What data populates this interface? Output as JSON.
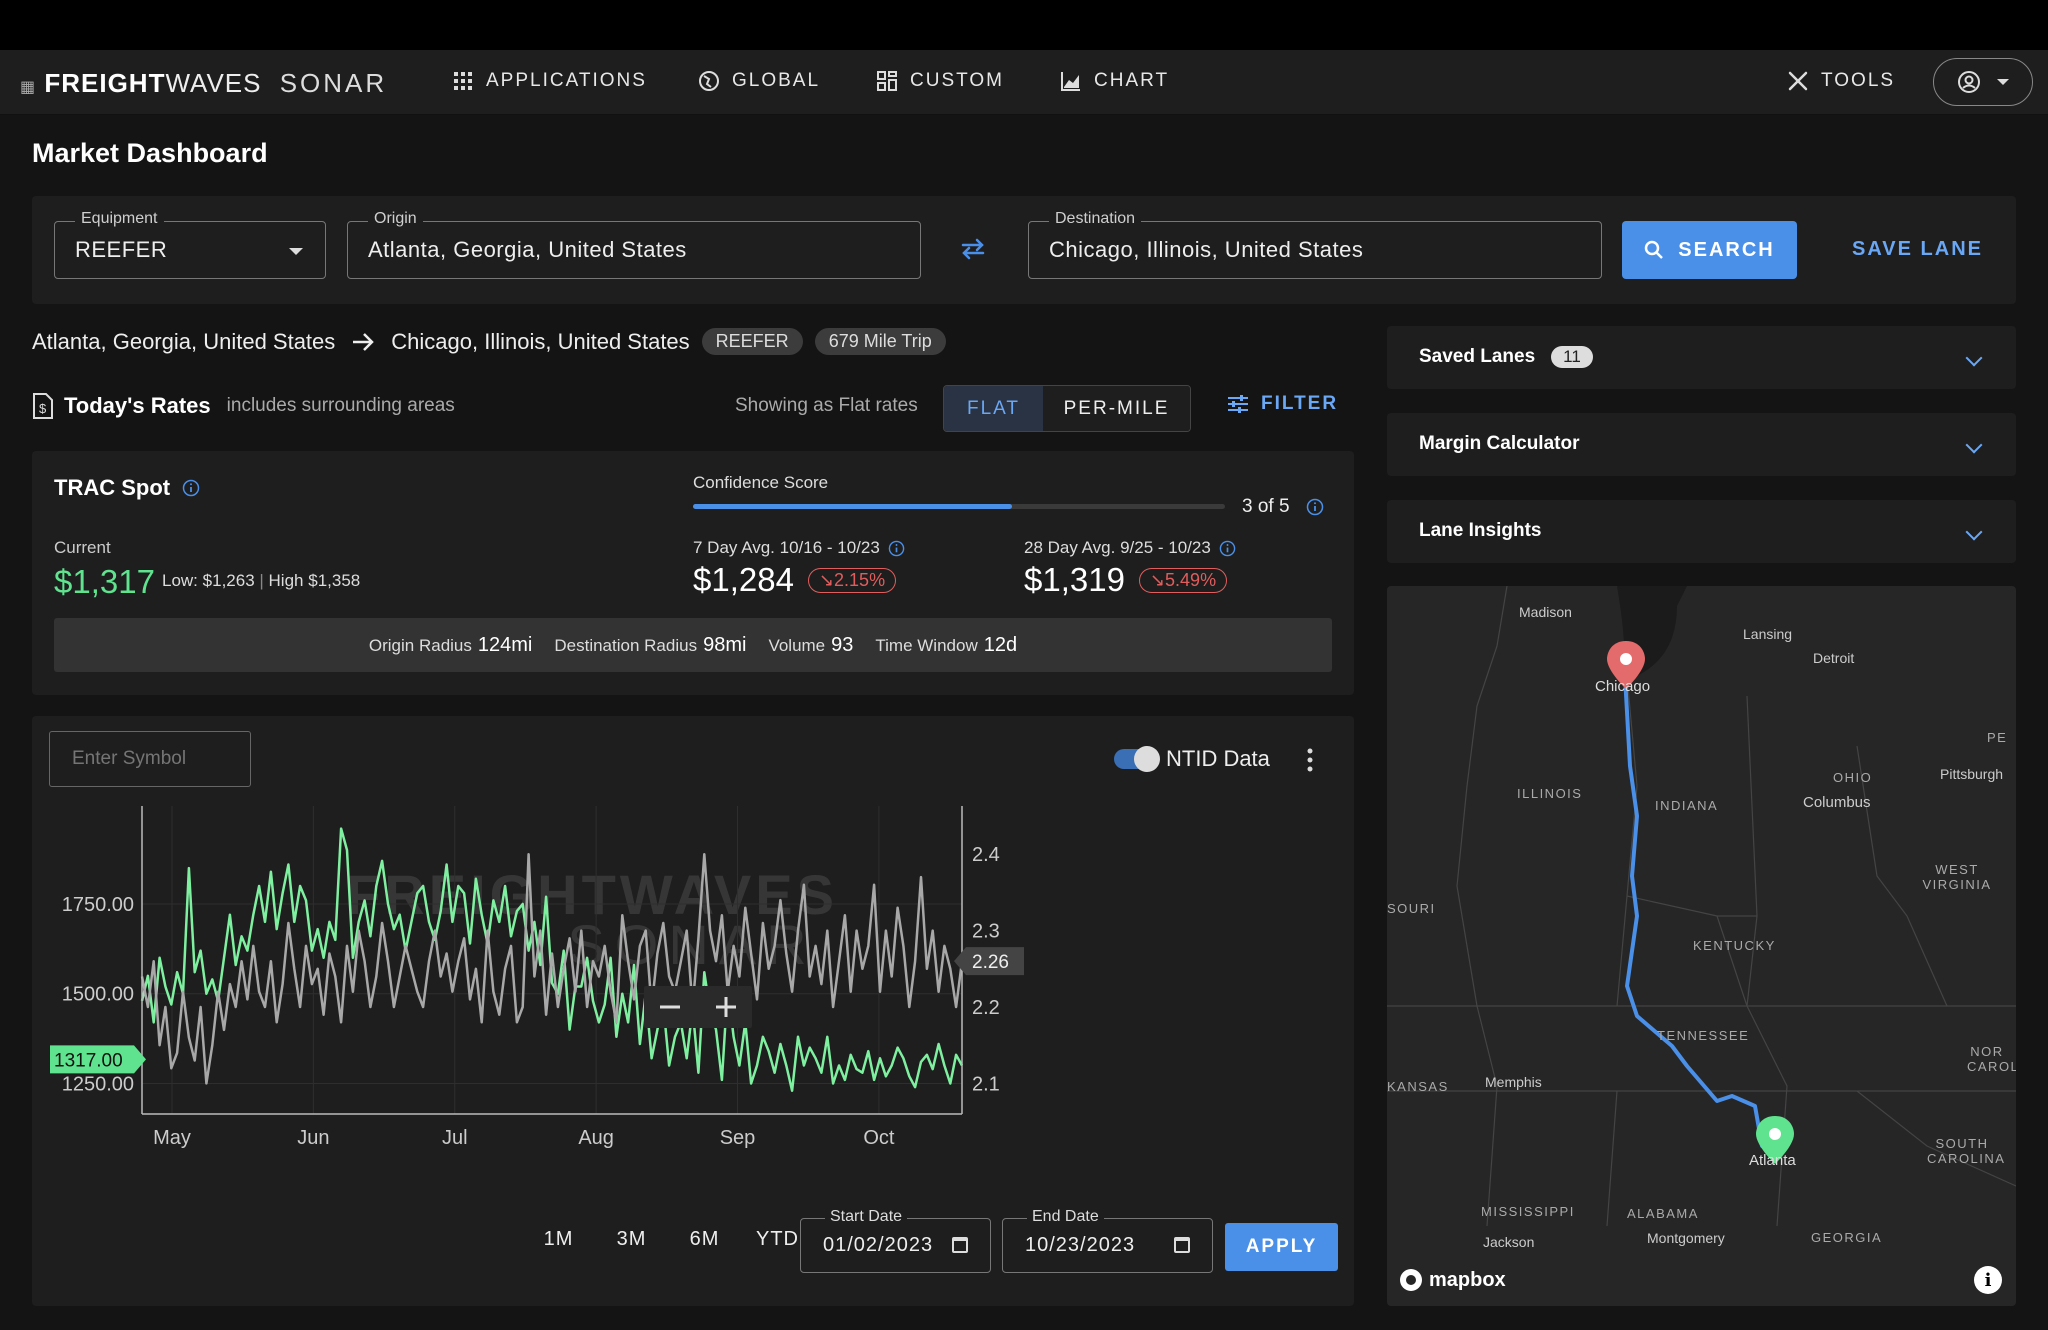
{
  "nav": {
    "logo_bold": "FREIGHT",
    "logo_mid": "WAVES",
    "logo_thin": "SONAR",
    "items": [
      {
        "label": "APPLICATIONS",
        "icon": "grid-icon"
      },
      {
        "label": "GLOBAL",
        "icon": "globe-icon"
      },
      {
        "label": "CUSTOM",
        "icon": "dashboard-icon"
      },
      {
        "label": "CHART",
        "icon": "chart-icon"
      }
    ],
    "tools_label": "TOOLS"
  },
  "page_title": "Market Dashboard",
  "search": {
    "equipment_label": "Equipment",
    "equipment_value": "REEFER",
    "origin_label": "Origin",
    "origin_value": "Atlanta, Georgia, United States",
    "destination_label": "Destination",
    "destination_value": "Chicago, Illinois, United States",
    "search_label": "SEARCH",
    "save_label": "SAVE LANE"
  },
  "lane": {
    "origin": "Atlanta, Georgia, United States",
    "destination": "Chicago, Illinois, United States",
    "equipment": "REEFER",
    "trip": "679 Mile Trip"
  },
  "rates": {
    "title": "Today's Rates",
    "subtitle": "includes surrounding areas",
    "showing": "Showing as Flat rates",
    "flat_label": "FLAT",
    "per_mile_label": "PER-MILE",
    "filter_label": "FILTER"
  },
  "trac": {
    "title": "TRAC Spot",
    "confidence_label": "Confidence Score",
    "confidence_value": 0.6,
    "confidence_text": "3 of 5",
    "current_label": "Current",
    "current_value": "$1,317",
    "low_label": "Low:",
    "low_value": "$1,263",
    "high_label": "High",
    "high_value": "$1,358",
    "avg7_label": "7 Day Avg. 10/16 - 10/23",
    "avg7_value": "$1,284",
    "avg7_change": "2.15%",
    "avg28_label": "28 Day Avg. 9/25 - 10/23",
    "avg28_value": "$1,319",
    "avg28_change": "5.49%",
    "origin_radius_label": "Origin Radius",
    "origin_radius": "124mi",
    "dest_radius_label": "Destination Radius",
    "dest_radius": "98mi",
    "volume_label": "Volume",
    "volume": "93",
    "time_window_label": "Time Window",
    "time_window": "12d"
  },
  "chart_panel": {
    "symbol_placeholder": "Enter Symbol",
    "ntid_label": "NTID Data",
    "watermark_top": "FREIGHTWAVES",
    "watermark_bottom": "SONAR",
    "range_buttons": [
      "1M",
      "3M",
      "6M",
      "YTD"
    ],
    "start_label": "Start Date",
    "start_value": "01/02/2023",
    "end_label": "End Date",
    "end_value": "10/23/2023",
    "apply_label": "APPLY"
  },
  "chart_data": {
    "type": "line",
    "x_months": [
      "May",
      "Jun",
      "Jul",
      "Aug",
      "Sep",
      "Oct"
    ],
    "y_left_ticks": [
      "1750.00",
      "1500.00",
      "1250.00"
    ],
    "y_right_ticks": [
      "2.4",
      "2.3",
      "2.2",
      "2.1"
    ],
    "y_left_range": [
      1165,
      1995
    ],
    "y_right_range": [
      2.06,
      2.45
    ],
    "left_current_label": "1317.00",
    "right_current_label": "2.26",
    "series": [
      {
        "axis": "left",
        "color": "#7ef0a0",
        "values": [
          1480,
          1550,
          1420,
          1600,
          1520,
          1470,
          1560,
          1500,
          1850,
          1560,
          1620,
          1500,
          1540,
          1480,
          1600,
          1720,
          1580,
          1660,
          1620,
          1720,
          1800,
          1700,
          1840,
          1680,
          1780,
          1860,
          1700,
          1800,
          1760,
          1620,
          1680,
          1600,
          1700,
          1650,
          1960,
          1900,
          1600,
          1700,
          1760,
          1660,
          1800,
          1870,
          1750,
          1680,
          1720,
          1620,
          1700,
          1780,
          1800,
          1700,
          1650,
          1730,
          1860,
          1700,
          1800,
          1780,
          1640,
          1820,
          1720,
          1640,
          1760,
          1700,
          1800,
          1660,
          1730,
          1750,
          1620,
          1700,
          1580,
          1770,
          1530,
          1500,
          1620,
          1400,
          1520,
          1520,
          1600,
          1480,
          1420,
          1470,
          1600,
          1380,
          1500,
          1420,
          1580,
          1360,
          1500,
          1320,
          1400,
          1470,
          1300,
          1380,
          1420,
          1320,
          1460,
          1280,
          1560,
          1450,
          1400,
          1260,
          1520,
          1380,
          1300,
          1420,
          1250,
          1300,
          1380,
          1340,
          1280,
          1360,
          1300,
          1230,
          1380,
          1300,
          1350,
          1320,
          1280,
          1380,
          1250,
          1300,
          1260,
          1330,
          1290,
          1280,
          1340,
          1260,
          1320,
          1270,
          1300,
          1350,
          1320,
          1270,
          1240,
          1310,
          1330,
          1290,
          1360,
          1300,
          1250,
          1330,
          1300
        ]
      },
      {
        "axis": "right",
        "color": "#a8a8a8",
        "values": [
          2.24,
          2.2,
          2.26,
          2.15,
          2.2,
          2.12,
          2.14,
          2.22,
          2.16,
          2.13,
          2.2,
          2.1,
          2.15,
          2.22,
          2.17,
          2.23,
          2.2,
          2.26,
          2.21,
          2.28,
          2.22,
          2.2,
          2.26,
          2.18,
          2.23,
          2.31,
          2.25,
          2.2,
          2.28,
          2.23,
          2.25,
          2.19,
          2.27,
          2.24,
          2.18,
          2.28,
          2.22,
          2.3,
          2.26,
          2.2,
          2.24,
          2.31,
          2.26,
          2.2,
          2.24,
          2.28,
          2.25,
          2.22,
          2.2,
          2.26,
          2.3,
          2.24,
          2.27,
          2.22,
          2.26,
          2.29,
          2.21,
          2.25,
          2.18,
          2.3,
          2.22,
          2.19,
          2.25,
          2.28,
          2.18,
          2.2,
          2.4,
          2.24,
          2.3,
          2.19,
          2.27,
          2.2,
          2.25,
          2.29,
          2.22,
          2.3,
          2.2,
          2.26,
          2.24,
          2.28,
          2.22,
          2.18,
          2.32,
          2.26,
          2.21,
          2.28,
          2.3,
          2.2,
          2.27,
          2.31,
          2.24,
          2.22,
          2.26,
          2.3,
          2.2,
          2.29,
          2.4,
          2.3,
          2.26,
          2.32,
          2.22,
          2.28,
          2.24,
          2.33,
          2.27,
          2.21,
          2.31,
          2.25,
          2.28,
          2.34,
          2.27,
          2.22,
          2.3,
          2.36,
          2.24,
          2.28,
          2.23,
          2.3,
          2.2,
          2.26,
          2.32,
          2.22,
          2.3,
          2.25,
          2.28,
          2.36,
          2.22,
          2.3,
          2.24,
          2.33,
          2.28,
          2.2,
          2.26,
          2.37,
          2.25,
          2.3,
          2.22,
          2.28,
          2.25,
          2.2,
          2.26
        ]
      }
    ]
  },
  "side": {
    "saved_lanes_label": "Saved Lanes",
    "saved_lanes_count": "11",
    "margin_label": "Margin Calculator",
    "insights_label": "Lane Insights"
  },
  "map": {
    "labels": [
      "ILLINOIS",
      "INDIANA",
      "OHIO",
      "KENTUCKY",
      "TENNESSEE",
      "MISSISSIPPI",
      "ALABAMA",
      "GEORGIA",
      "SOUTH CAROLINA",
      "WEST VIRGINIA",
      "SOURI",
      "KANSAS",
      "NOR CAROL",
      "PE"
    ],
    "cities": [
      "Madison",
      "Lansing",
      "Detroit",
      "Chicago",
      "Columbus",
      "Pittsburgh",
      "Memphis",
      "Atlanta",
      "Jackson",
      "Montgomery"
    ],
    "brand": "mapbox"
  }
}
